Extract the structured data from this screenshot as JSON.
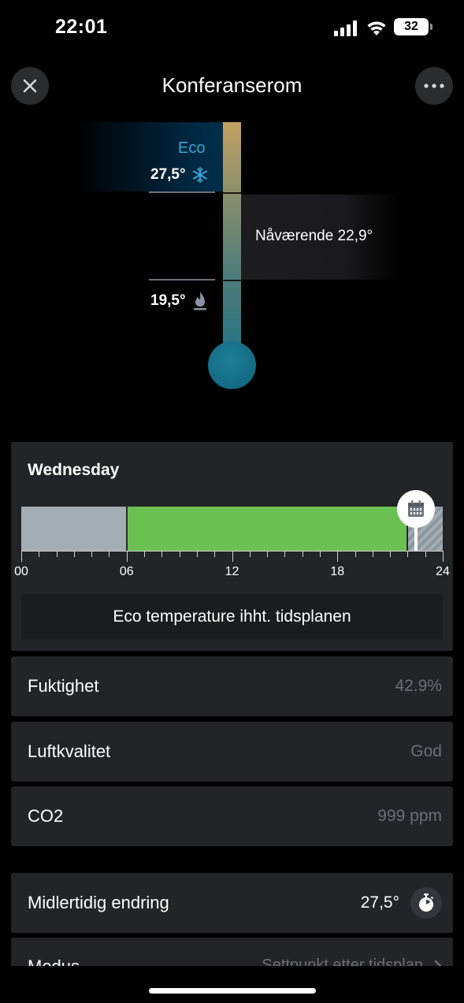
{
  "status_bar": {
    "time": "22:01",
    "battery": "32"
  },
  "header": {
    "title": "Konferanserom",
    "close_icon": "close-icon",
    "more_icon": "more-icon"
  },
  "thermostat": {
    "mode_label": "Eco",
    "upper_temp": "27,5°",
    "upper_icon": "snowflake-icon",
    "lower_temp": "19,5°",
    "lower_icon": "flame-icon",
    "current_label": "Nåværende 22,9°"
  },
  "schedule": {
    "day": "Wednesday",
    "ticks": [
      "00",
      "06",
      "12",
      "18",
      "24"
    ],
    "segments": [
      {
        "state": "off",
        "from_hour": 0,
        "to_hour": 6
      },
      {
        "state": "on",
        "from_hour": 6,
        "to_hour": 22
      },
      {
        "state": "eco",
        "from_hour": 22,
        "to_hour": 24
      }
    ],
    "current_hour": 22,
    "marker_icon": "calendar-icon",
    "note": "Eco temperature ihht. tidsplanen",
    "colors": {
      "off": "#a3adb3",
      "on": "#6ac152"
    }
  },
  "readings": [
    {
      "label": "Fuktighet",
      "value": "42.9%"
    },
    {
      "label": "Luftkvalitet",
      "value": "God"
    },
    {
      "label": "CO2",
      "value": "999 ppm"
    }
  ],
  "temporary_change": {
    "label": "Midlertidig endring",
    "value": "27,5°",
    "icon": "stopwatch-icon"
  },
  "mode": {
    "label": "Modus",
    "value": "Settpunkt etter tidsplan",
    "icon": "chevron-right-icon"
  }
}
